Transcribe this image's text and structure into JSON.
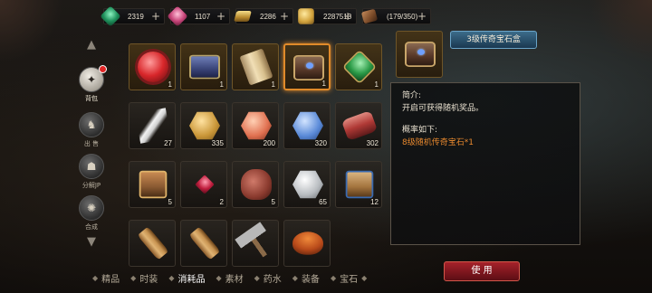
{
  "currencies": [
    {
      "icon": "emerald-icon",
      "value": "2319"
    },
    {
      "icon": "ruby-icon",
      "value": "1107"
    },
    {
      "icon": "gold-bar-icon",
      "value": "2286"
    },
    {
      "icon": "gold-coin-icon",
      "value": "2287513"
    },
    {
      "icon": "wood-icon",
      "value": "(179/350)"
    }
  ],
  "plus": "+",
  "sidenav": {
    "up": "▲",
    "down": "▼",
    "items": [
      {
        "label": "背包",
        "icon": "backpack-icon",
        "glyph": "✦",
        "active": true
      },
      {
        "label": "出 售",
        "icon": "sell-icon",
        "glyph": "♞"
      },
      {
        "label": "分解JP",
        "icon": "decompose-icon",
        "glyph": "☗"
      },
      {
        "label": "合成",
        "icon": "synthesize-icon",
        "glyph": "✺"
      }
    ]
  },
  "items": [
    {
      "art": "a-redorb",
      "count": "1",
      "name": "red-gem-item",
      "rarity": "gold"
    },
    {
      "art": "a-blueChest",
      "count": "1",
      "name": "blue-chest-item",
      "rarity": "gold"
    },
    {
      "art": "a-scroll",
      "count": "1",
      "name": "scroll-item",
      "rarity": "gold"
    },
    {
      "art": "a-chest",
      "count": "1",
      "name": "legendary-gem-box-item",
      "rarity": "gold",
      "selected": true
    },
    {
      "art": "a-green",
      "count": "1",
      "name": "green-gem-item",
      "rarity": "gold"
    },
    {
      "art": "a-feather",
      "count": "27",
      "name": "feather-item"
    },
    {
      "art": "a-hexgold",
      "count": "335",
      "name": "gold-medal-item"
    },
    {
      "art": "a-hexred",
      "count": "200",
      "name": "red-medal-item"
    },
    {
      "art": "a-hexblue",
      "count": "320",
      "name": "blue-medal-item"
    },
    {
      "art": "a-meat",
      "count": "302",
      "name": "meat-item"
    },
    {
      "art": "a-gift",
      "count": "5",
      "name": "gift-box-item"
    },
    {
      "art": "a-rubysm",
      "count": "2",
      "name": "ruby-shard-item"
    },
    {
      "art": "a-pouch",
      "count": "5",
      "name": "pouch-item"
    },
    {
      "art": "a-silver",
      "count": "65",
      "name": "silver-medal-item"
    },
    {
      "art": "a-scrollbox",
      "count": "12",
      "name": "scroll-box-item"
    },
    {
      "art": "a-roll",
      "count": "",
      "name": "parchment-roll-item"
    },
    {
      "art": "a-roll",
      "count": "",
      "name": "parchment-roll-item-2"
    },
    {
      "art": "a-hammer",
      "count": "",
      "name": "hammer-item"
    },
    {
      "art": "a-bowl",
      "count": "",
      "name": "bowl-item"
    }
  ],
  "detail": {
    "title": "3级传奇宝石盒",
    "intro_label": "简介:",
    "intro_text": "开启可获得随机奖品。",
    "prob_label": "概率如下:",
    "prob_text": "8级随机传奇宝石*1"
  },
  "tabs": [
    {
      "label": "精品"
    },
    {
      "label": "时装"
    },
    {
      "label": "消耗品",
      "active": true
    },
    {
      "label": "素材"
    },
    {
      "label": "药水"
    },
    {
      "label": "装备"
    },
    {
      "label": "宝石"
    }
  ],
  "chevron": "◆",
  "use_label": "使 用",
  "colors": {
    "accent_orange": "#e8892e",
    "use_red": "#a6222a",
    "selected_border": "#e08a2a"
  }
}
